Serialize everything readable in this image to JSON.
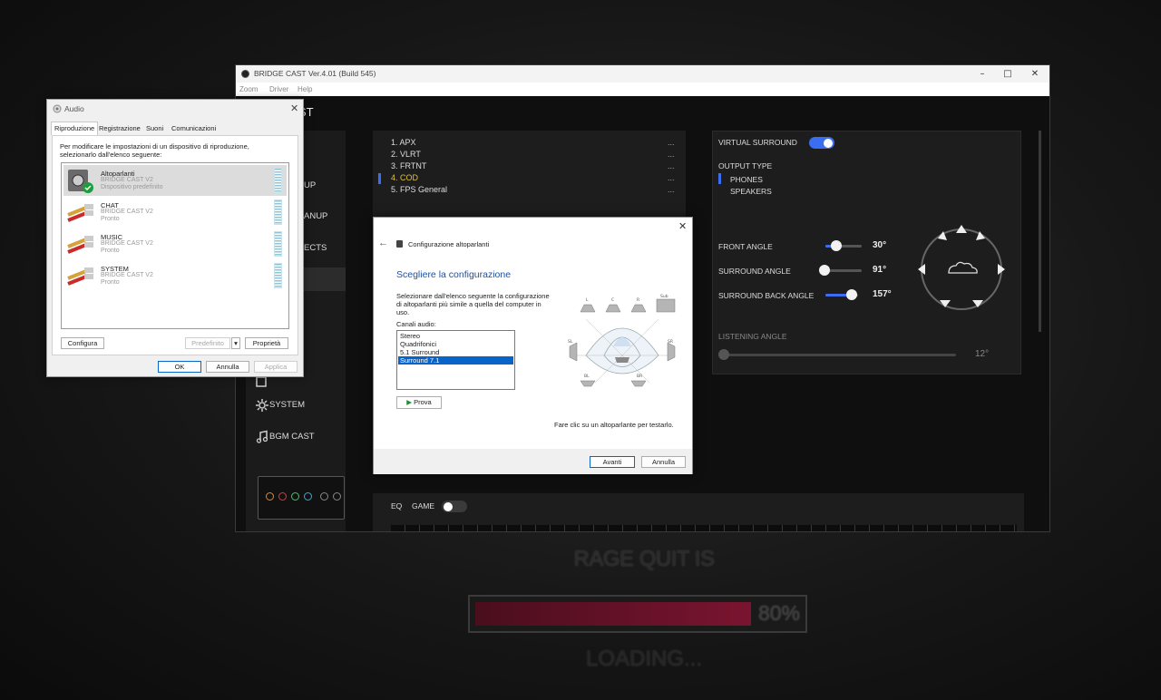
{
  "background": {
    "title": "RAGE QUIT IS",
    "progress_percent": 80,
    "progress_label": "80%",
    "loading": "LOADING..."
  },
  "bridge_cast": {
    "window_title": "BRIDGE CAST Ver.4.01 (Build 545)",
    "menu": [
      "Zoom",
      "Driver",
      "Help"
    ],
    "app_title": "BRIDGE CAST",
    "app_title_visible": "ST",
    "sidebar": [
      {
        "label": "UP",
        "icon": "setup-icon"
      },
      {
        "label": "ANUP",
        "icon": "cleanup-icon"
      },
      {
        "label": "ECTS",
        "icon": "effects-icon"
      },
      {
        "label": "",
        "icon": "surround-icon"
      },
      {
        "label": "",
        "icon": "other-icon"
      },
      {
        "label": "SYSTEM",
        "icon": "gear-icon"
      },
      {
        "label": "BGM CAST",
        "icon": "music-icon"
      }
    ],
    "presets": [
      {
        "label": "1. APX",
        "more": "..."
      },
      {
        "label": "2. VLRT",
        "more": "..."
      },
      {
        "label": "3. FRTNT",
        "more": "..."
      },
      {
        "label": "4. COD",
        "more": "..."
      },
      {
        "label": "5. FPS General",
        "more": "..."
      }
    ],
    "active_preset_index": 3,
    "surround": {
      "virtual_surround_label": "VIRTUAL SURROUND",
      "virtual_surround_on": true,
      "output_type_label": "OUTPUT TYPE",
      "output_options": [
        "PHONES",
        "SPEAKERS"
      ],
      "output_selected": "PHONES",
      "front_angle_label": "FRONT ANGLE",
      "front_angle_value": "30°",
      "surround_angle_label": "SURROUND ANGLE",
      "surround_angle_value": "91°",
      "surround_back_angle_label": "SURROUND BACK ANGLE",
      "surround_back_angle_value": "157°",
      "listening_angle_label": "LISTENING ANGLE",
      "listening_angle_value": "12°"
    },
    "eq": {
      "eq_label": "EQ",
      "game_label": "GAME",
      "game_on": false
    },
    "colors": {
      "accent": "#3b6df0",
      "active_preset": "#e3c23a"
    }
  },
  "audio_dialog": {
    "title": "Audio",
    "tabs": [
      "Riproduzione",
      "Registrazione",
      "Suoni",
      "Comunicazioni"
    ],
    "instructions": "Per modificare le impostazioni di un dispositivo di riproduzione, selezionarlo dall'elenco seguente:",
    "devices": [
      {
        "name": "Altoparlanti",
        "driver": "BRIDGE CAST V2",
        "status": "Dispositivo predefinito"
      },
      {
        "name": "CHAT",
        "driver": "BRIDGE CAST V2",
        "status": "Pronto"
      },
      {
        "name": "MUSIC",
        "driver": "BRIDGE CAST V2",
        "status": "Pronto"
      },
      {
        "name": "SYSTEM",
        "driver": "BRIDGE CAST V2",
        "status": "Pronto"
      }
    ],
    "configure_button": "Configura",
    "default_button": "Predefinito",
    "properties_button": "Proprietà",
    "ok_button": "OK",
    "cancel_button": "Annulla",
    "apply_button": "Applica"
  },
  "speaker_dialog": {
    "title": "Configurazione altoparlanti",
    "heading": "Scegliere la configurazione",
    "description": "Selezionare dall'elenco seguente la configurazione di altoparlanti più simile a quella del computer in uso.",
    "channels_label": "Canali audio:",
    "channels": [
      "Stereo",
      "Quadrifonici",
      "5.1 Surround",
      "Surround 7.1"
    ],
    "selected_channel": "Surround 7.1",
    "test_button": "Prova",
    "hint": "Fare clic su un altoparlante per testarlo.",
    "speaker_labels": [
      "L",
      "C",
      "R",
      "Sub",
      "SL",
      "SR",
      "BL",
      "BR"
    ],
    "next_button": "Avanti",
    "cancel_button": "Annulla"
  }
}
